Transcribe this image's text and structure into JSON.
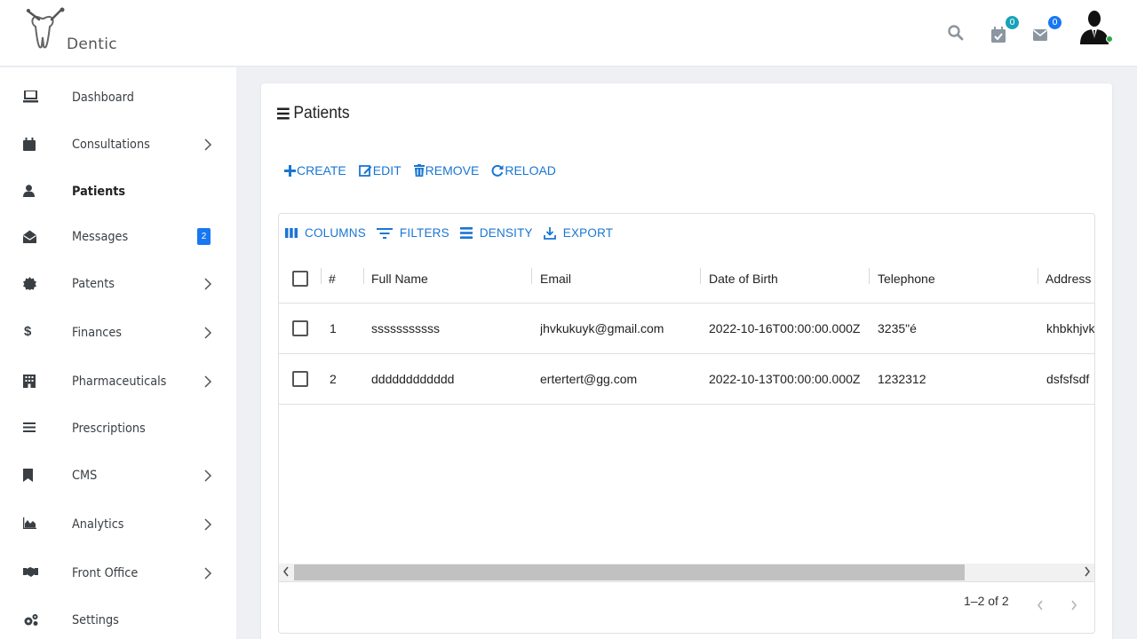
{
  "app": {
    "name": "Dentic",
    "notifications_count": "0",
    "messages_count": "0"
  },
  "sidebar": {
    "items": [
      {
        "label": "Dashboard",
        "icon": "laptop-icon"
      },
      {
        "label": "Consultations",
        "icon": "calendar-icon"
      },
      {
        "label": "Patients",
        "icon": "user-icon"
      },
      {
        "label": "Messages",
        "icon": "envelope-open-icon",
        "badge": "2"
      },
      {
        "label": "Patents",
        "icon": "certificate-icon"
      },
      {
        "label": "Finances",
        "icon": "dollar-icon"
      },
      {
        "label": "Pharmaceuticals",
        "icon": "building-icon"
      },
      {
        "label": "Prescriptions",
        "icon": "list-icon"
      },
      {
        "label": "CMS",
        "icon": "bookmark-icon"
      },
      {
        "label": "Analytics",
        "icon": "area-chart-icon"
      },
      {
        "label": "Front Office",
        "icon": "handshake-icon"
      },
      {
        "label": "Settings",
        "icon": "cogs-icon"
      }
    ]
  },
  "page": {
    "title": "Patients"
  },
  "toolbar": {
    "create": "CREATE",
    "edit": "EDIT",
    "remove": "REMOVE",
    "reload": "RELOAD"
  },
  "grid_toolbar": {
    "columns": "COLUMNS",
    "filters": "FILTERS",
    "density": "DENSITY",
    "export": "EXPORT"
  },
  "table": {
    "columns": [
      "#",
      "Full Name",
      "Email",
      "Date of Birth",
      "Telephone",
      "Address"
    ],
    "rows": [
      [
        "1",
        "sssssssssss",
        "jhvkukuyk@gmail.com",
        "2022-10-16T00:00:00.000Z",
        "3235\"é",
        "khbkhjvk"
      ],
      [
        "2",
        "dddddddddddd",
        "ertertert@gg.com",
        "2022-10-13T00:00:00.000Z",
        "1232312",
        "dsfsfsdf"
      ]
    ]
  },
  "pagination": {
    "range": "1–2 of 2"
  },
  "colors": {
    "accent": "#1976d2",
    "badge_teal": "#17a2b8",
    "badge_blue": "#1877f2",
    "online": "#28a745"
  }
}
